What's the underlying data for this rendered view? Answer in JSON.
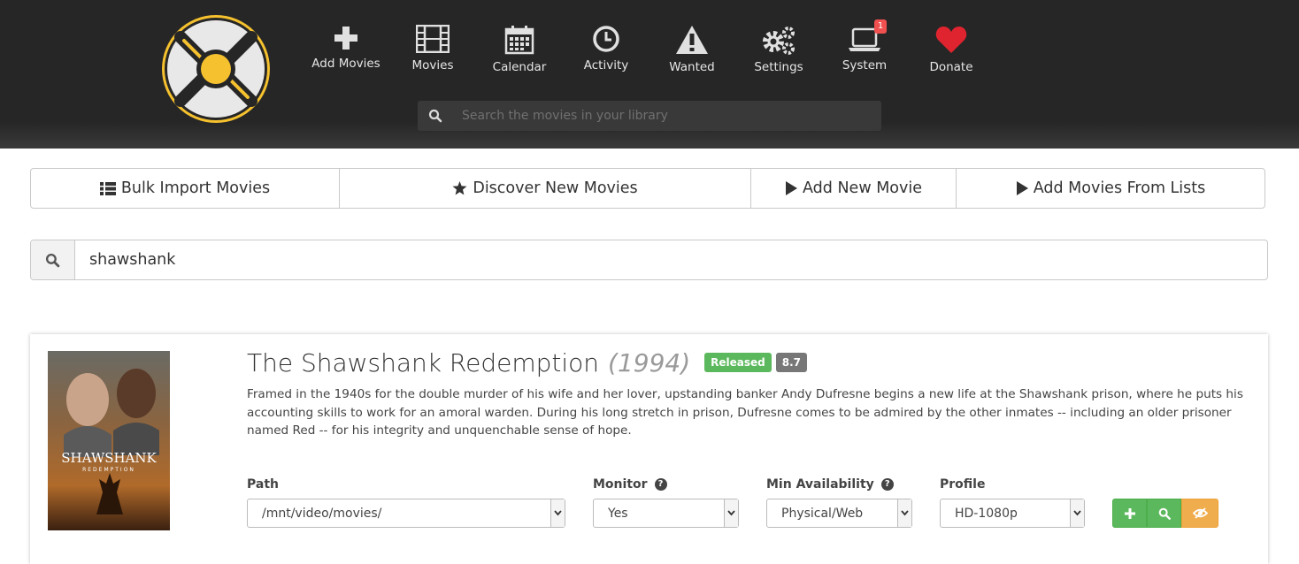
{
  "nav": {
    "items": [
      {
        "label": "Add Movies",
        "icon": "plus-icon"
      },
      {
        "label": "Movies",
        "icon": "film-icon"
      },
      {
        "label": "Calendar",
        "icon": "calendar-icon"
      },
      {
        "label": "Activity",
        "icon": "clock-icon"
      },
      {
        "label": "Wanted",
        "icon": "warning-icon"
      },
      {
        "label": "Settings",
        "icon": "gears-icon"
      },
      {
        "label": "System",
        "icon": "laptop-icon",
        "badge": "1"
      },
      {
        "label": "Donate",
        "icon": "heart-icon"
      }
    ],
    "search_placeholder": "Search the movies in your library"
  },
  "tabs": [
    {
      "label": "Bulk Import Movies",
      "icon": "list-icon"
    },
    {
      "label": "Discover New Movies",
      "icon": "star-icon"
    },
    {
      "label": "Add New Movie",
      "icon": "play-icon"
    },
    {
      "label": "Add Movies From Lists",
      "icon": "play-icon"
    }
  ],
  "search": {
    "value": "shawshank"
  },
  "result": {
    "title": "The Shawshank Redemption",
    "year": "(1994)",
    "status": "Released",
    "rating": "8.7",
    "overview": "Framed in the 1940s for the double murder of his wife and her lover, upstanding banker Andy Dufresne begins a new life at the Shawshank prison, where he puts his accounting skills to work for an amoral warden. During his long stretch in prison, Dufresne comes to be admired by the other inmates -- including an older prisoner named Red -- for his integrity and unquenchable sense of hope.",
    "poster_text": "SHAWSHANK",
    "poster_subtext": "REDEMPTION",
    "fields": {
      "path": {
        "label": "Path",
        "value": "/mnt/video/movies/"
      },
      "monitor": {
        "label": "Monitor",
        "value": "Yes"
      },
      "min_availability": {
        "label": "Min Availability",
        "value": "Physical/Web"
      },
      "profile": {
        "label": "Profile",
        "value": "HD-1080p"
      }
    }
  },
  "colors": {
    "header_bg": "#262626",
    "logo_yellow": "#f5c12e",
    "success": "#5cb85c",
    "warning": "#f0ad4e",
    "donate_red": "#e0242f",
    "badge_red": "#f05050"
  }
}
